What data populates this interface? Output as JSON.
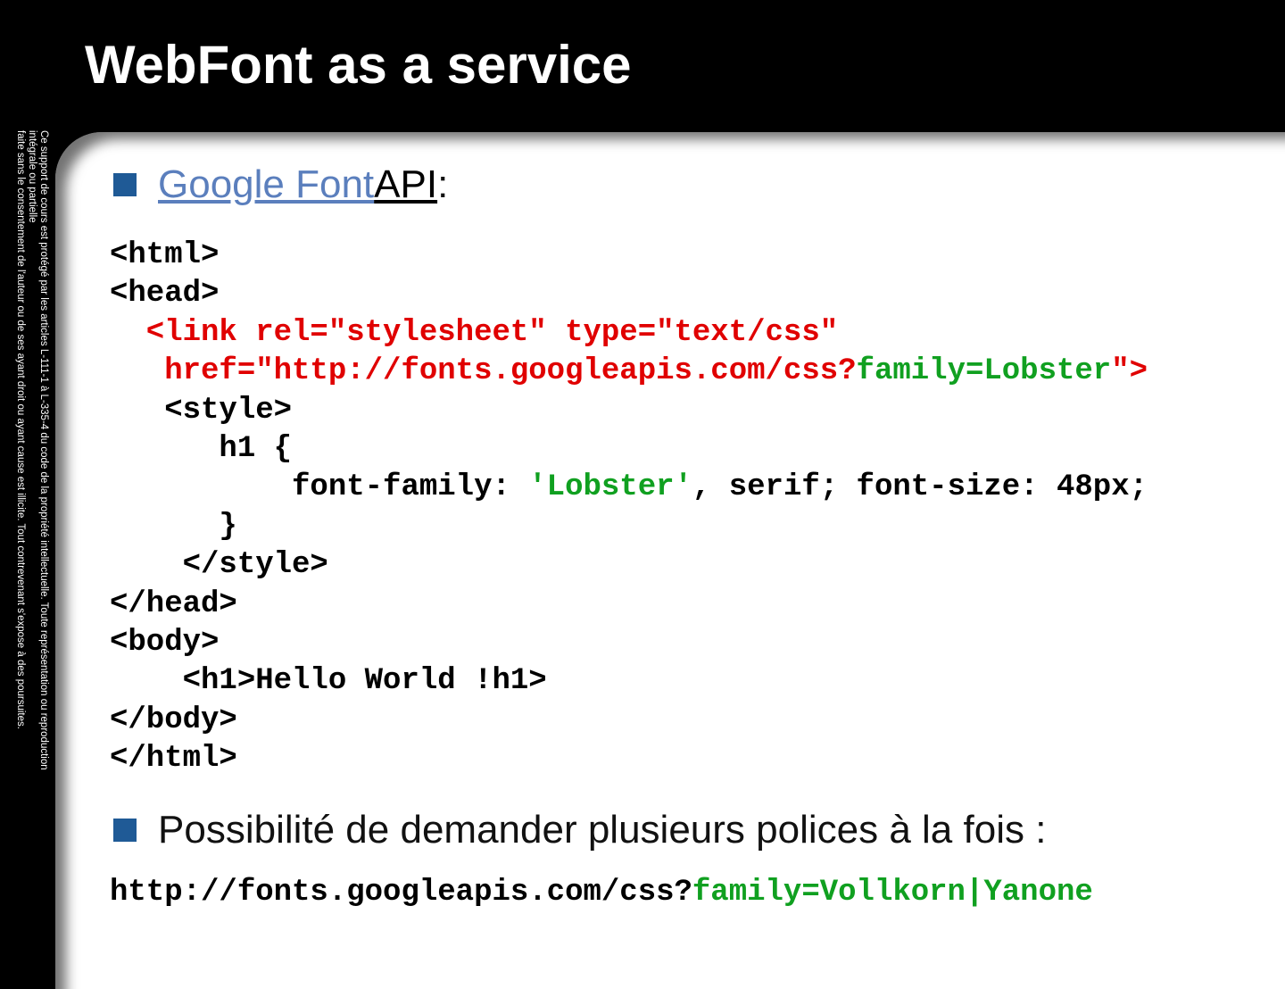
{
  "title": "WebFont as a service",
  "legal": {
    "line1": "Ce support de cours est protégé par les articles L-111-1 à L-335-4 du code de la propriété intellectuelle. Toute représentation ou reproduction intégrale ou partielle",
    "line2": "faite sans le consentement de l'auteur ou de ses ayant droit ou ayant cause est illicite. Tout contrevenant s'expose à des poursuites."
  },
  "bullet1": {
    "link": "Google Font ",
    "api": "API",
    "suffix": " :"
  },
  "code": {
    "l1": "<html>",
    "l2": "<head>",
    "l3": "  <link rel=\"stylesheet\" type=\"text/css\"",
    "l4a": "   href=\"http://fonts.googleapis.com/css?",
    "l4b": "family=Lobster",
    "l4c": "\">",
    "l5": "   <style>",
    "l6": "      h1 {",
    "l7a": "          font-family: ",
    "l7b": "'Lobster'",
    "l7c": ", serif; font-size: 48px;",
    "l8": "      }",
    "l9": "    </style>",
    "l10": "</head>",
    "l11": "<body>",
    "l12": "    <h1>Hello World !h1>",
    "l13": "</body>",
    "l14": "</html>"
  },
  "bullet2": "Possibilité de demander plusieurs polices à la fois :",
  "url": {
    "a": "http://fonts.googleapis.com/css?",
    "b": "family=Vollkorn|Yanone"
  },
  "colors": {
    "red": "#e00000",
    "green": "#10a020",
    "bullet": "#1f5a96",
    "link": "#5b7fbd"
  }
}
